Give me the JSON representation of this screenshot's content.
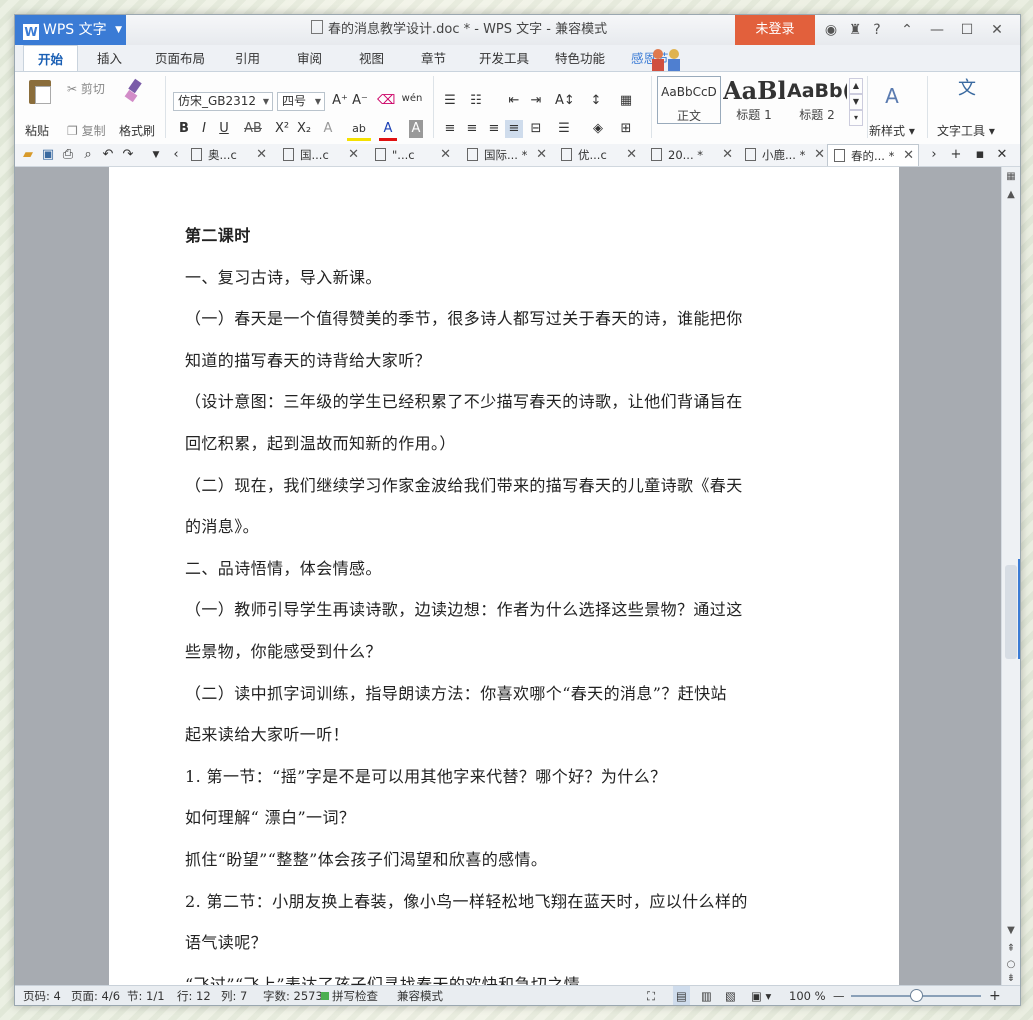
{
  "app": {
    "name": "WPS 文字",
    "window_title": "春的消息教学设计.doc * - WPS 文字 - 兼容模式",
    "login_label": "未登录",
    "help_label": "?"
  },
  "menu_tabs": [
    "开始",
    "插入",
    "页面布局",
    "引用",
    "审阅",
    "视图",
    "章节",
    "开发工具",
    "特色功能"
  ],
  "festival_label": "感恩节",
  "ribbon": {
    "paste": "粘贴",
    "cut": "剪切",
    "copy": "复制",
    "format_painter": "格式刷",
    "font_name": "仿宋_GB2312",
    "font_size": "四号",
    "styles": [
      {
        "sample": "AaBbCcD",
        "name": "正文"
      },
      {
        "sample": "AaBl",
        "name": "标题 1"
      },
      {
        "sample": "AaBb(",
        "name": "标题 2"
      }
    ],
    "new_style": "新样式",
    "text_tools": "文字工具",
    "bold": "B",
    "italic": "I",
    "underline": "U",
    "strike": "AB",
    "superscript": "X²",
    "subscript": "X₂",
    "font_color": "A",
    "highlight": "ab",
    "char_shade": "A",
    "phonetic": "wén"
  },
  "doc_tabs": [
    {
      "label": "奥...c",
      "modified": false
    },
    {
      "label": "国...c",
      "modified": false
    },
    {
      "label": "\"...c",
      "modified": false
    },
    {
      "label": "国际... *",
      "modified": true
    },
    {
      "label": "优...c",
      "modified": false
    },
    {
      "label": "20... *",
      "modified": true
    },
    {
      "label": "小鹿... *",
      "modified": true
    },
    {
      "label": "春的... *",
      "modified": true,
      "active": true
    }
  ],
  "document": {
    "paragraphs": [
      "第二课时",
      "一、复习古诗，导入新课。",
      "（一）春天是一个值得赞美的季节，很多诗人都写过关于春天的诗，谁能把你",
      "知道的描写春天的诗背给大家听？",
      "（设计意图：三年级的学生已经积累了不少描写春天的诗歌，让他们背诵旨在",
      "回忆积累，起到温故而知新的作用。）",
      "（二）现在，我们继续学习作家金波给我们带来的描写春天的儿童诗歌《春天",
      "的消息》。",
      "二、品诗悟情，体会情感。",
      "（一）教师引导学生再读诗歌，边读边想：作者为什么选择这些景物？通过这",
      "些景物，你能感受到什么？",
      "（二）读中抓字词训练，指导朗读方法：你喜欢哪个“春天的消息”？赶快站",
      "起来读给大家听一听！",
      "1. 第一节：“摇”字是不是可以用其他字来代替？哪个好？为什么？",
      "如何理解“ 漂白”一词？",
      "抓住“盼望”“整整”体会孩子们渴望和欣喜的感情。",
      "2. 第二节：小朋友换上春装，像小鸟一样轻松地飞翔在蓝天时，应以什么样的",
      "语气读呢？",
      "“飞过”“飞上”表达了孩子们寻找春天的欢快和急切之情。"
    ]
  },
  "status": {
    "page_no": "页码: 4",
    "pages": "页面: 4/6",
    "section": "节: 1/1",
    "line": "行: 12",
    "col": "列: 7",
    "word_count": "字数: 2573",
    "spell_check": "拼写检查",
    "compat_mode": "兼容模式",
    "zoom": "100 %"
  },
  "colors": {
    "accent": "#3a7bd5",
    "login_bg": "#e2603c"
  }
}
